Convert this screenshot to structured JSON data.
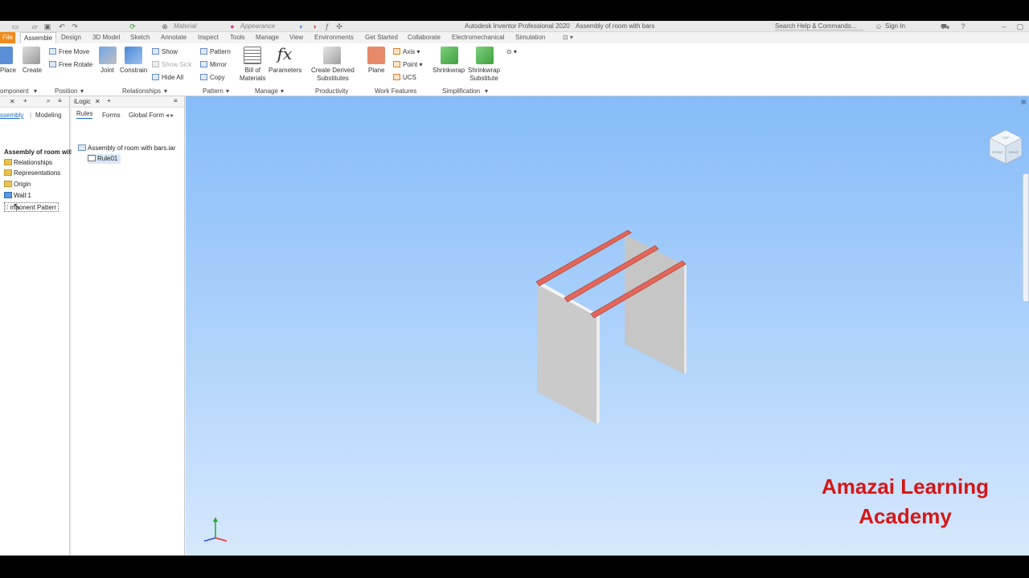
{
  "titlebar": {
    "material": "Material",
    "appearance": "Appearance",
    "app_title": "Autodesk Inventor Professional 2020",
    "doc_title": "Assembly of room with bars",
    "search": "Search Help & Commands...",
    "sign_in": "Sign In"
  },
  "tabs": [
    "File",
    "Assemble",
    "Design",
    "3D Model",
    "Sketch",
    "Annotate",
    "Inspect",
    "Tools",
    "Manage",
    "View",
    "Environments",
    "Get Started",
    "Collaborate",
    "Electromechanical",
    "Simulation"
  ],
  "ribbon": {
    "place": "Place",
    "create": "Create",
    "component_group": "omponent",
    "free_move": "Free Move",
    "free_rotate": "Free Rotate",
    "position_group": "Position",
    "joint": "Joint",
    "constrain": "Constrain",
    "show": "Show",
    "show_sick": "Show Sick",
    "hide_all": "Hide All",
    "relationships_group": "Relationships",
    "pattern": "Pattern",
    "mirror": "Mirror",
    "copy": "Copy",
    "pattern_group": "Pattern",
    "bom_line1": "Bill of",
    "bom_line2": "Materials",
    "parameters": "Parameters",
    "manage_group": "Manage",
    "derived_line1": "Create Derived",
    "derived_line2": "Substitutes",
    "productivity_group": "Productivity",
    "plane": "Plane",
    "axis": "Axis",
    "point": "Point",
    "ucs": "UCS",
    "workfeatures_group": "Work Features",
    "shrinkwrap": "Shrinkwrap",
    "shrinkwrap_sub_line1": "Shrinkwrap",
    "shrinkwrap_sub_line2": "Substitute",
    "simplification_group": "Simplification"
  },
  "browser": {
    "tab_assembly": "ssembly",
    "tab_modeling": "Modeling",
    "root": "Assembly of room with",
    "items": [
      "Relationships",
      "Representations",
      "Origin",
      "Wall:1",
      "mponent Patterr"
    ]
  },
  "ilogic": {
    "title": "iLogic",
    "tab_rules": "Rules",
    "tab_forms": "Forms",
    "tab_global": "Global Form",
    "tree_root": "Assembly of room with bars.iar",
    "rule": "Rule01"
  },
  "viewcube": {
    "top": "TOP",
    "front": "FRONT",
    "right": "RIGHT"
  },
  "watermark": {
    "line1": "Amazai Learning",
    "line2": "Academy"
  },
  "colors": {
    "file_tab": "#f08a1b",
    "accent": "#1b6ac9",
    "bar": "#e2675a",
    "wall": "#c9c9c9",
    "watermark": "#d31717"
  }
}
